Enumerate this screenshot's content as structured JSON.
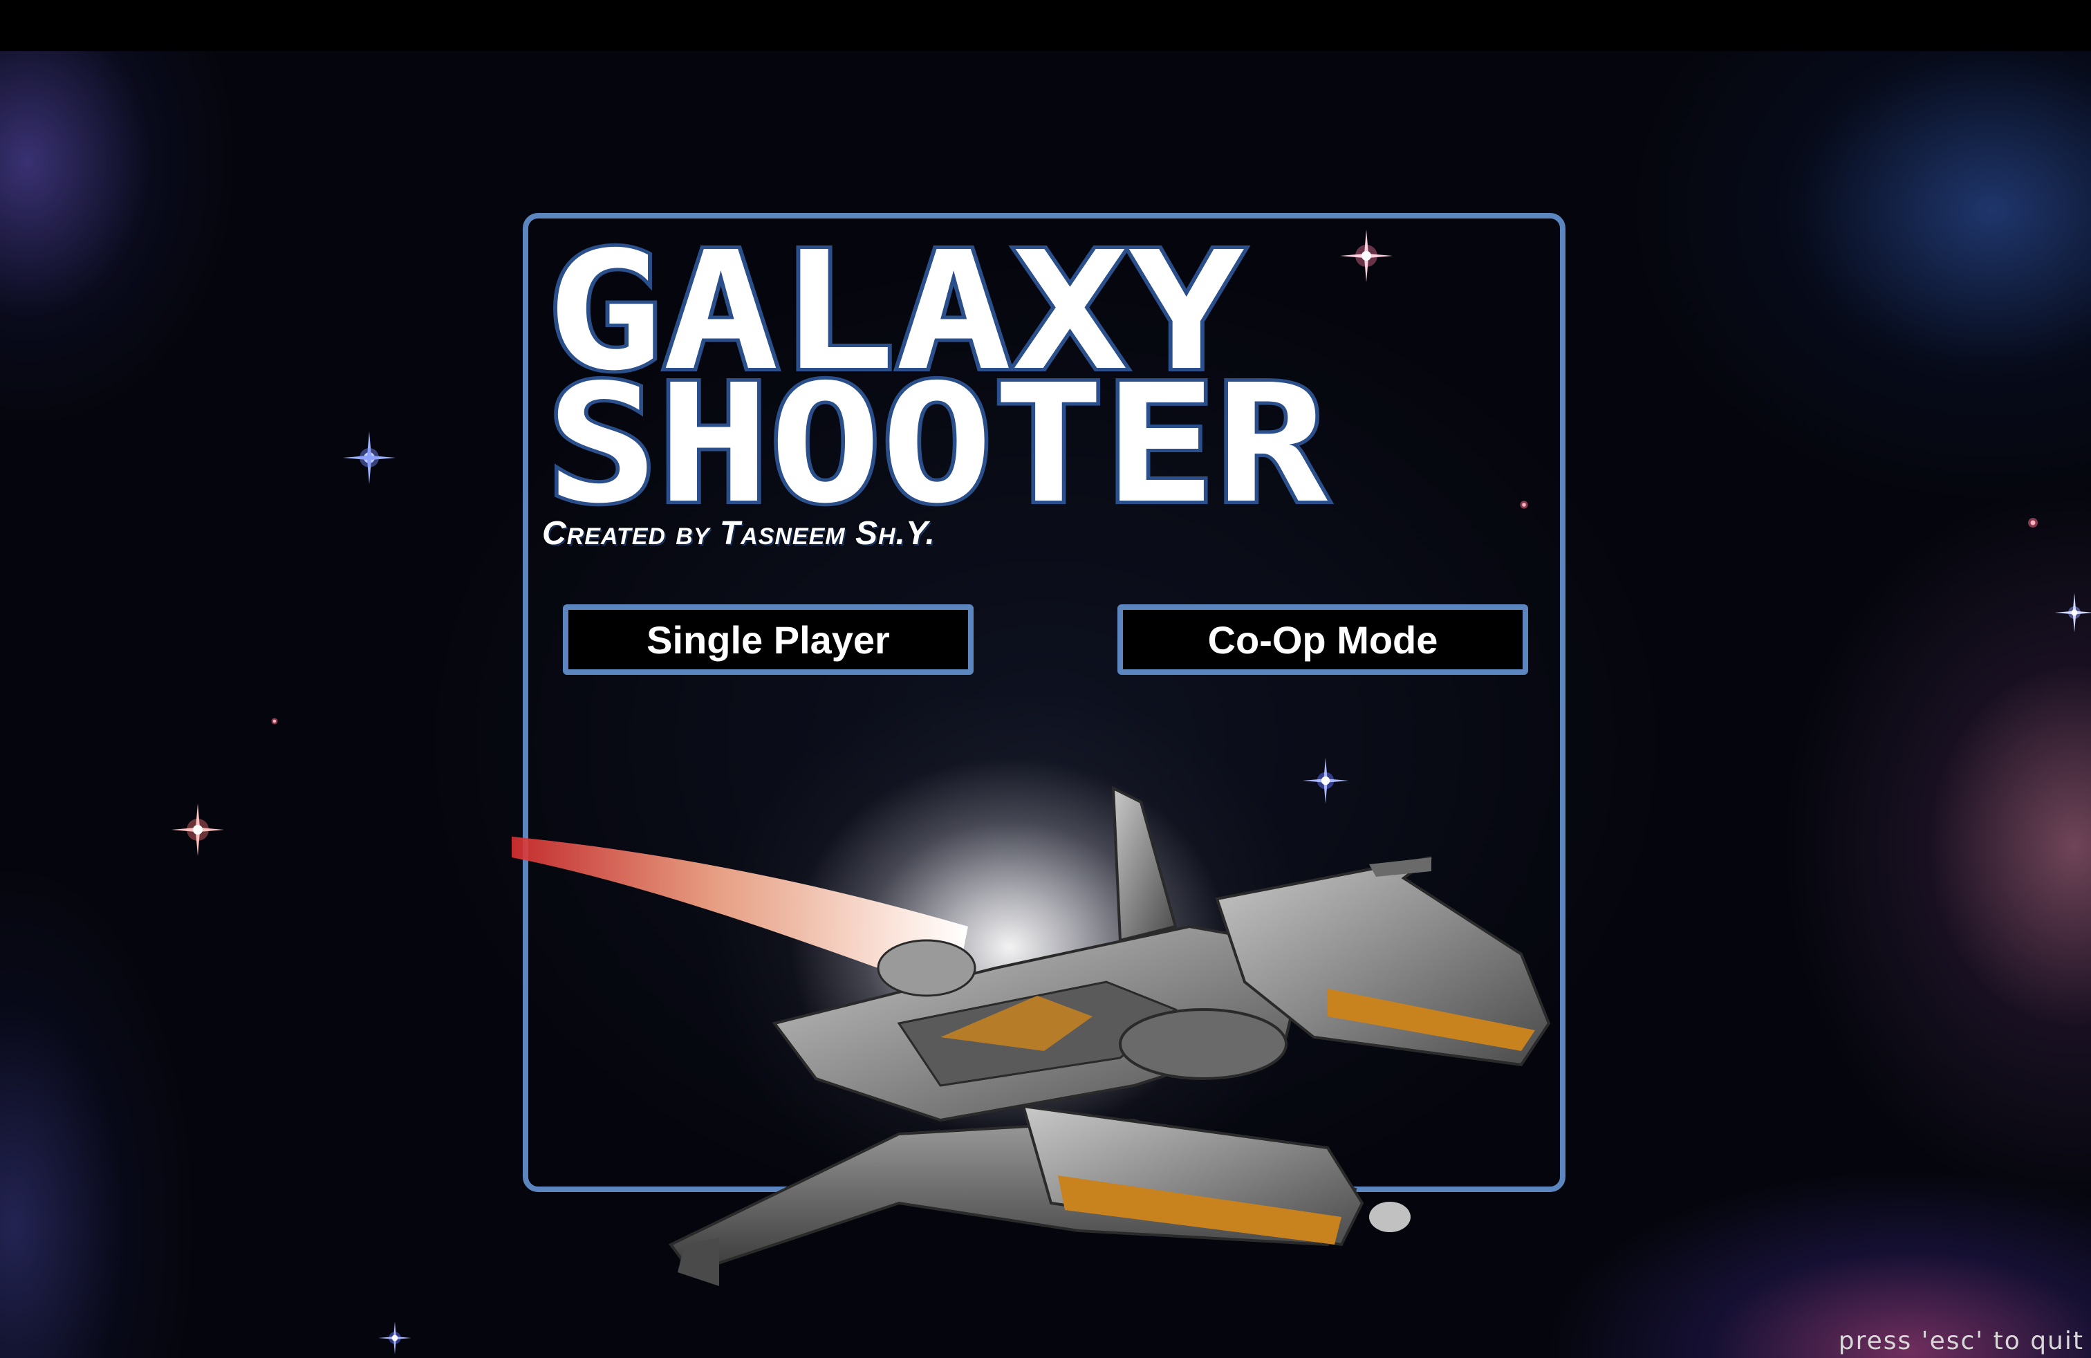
{
  "game": {
    "title_line1": "GALAXY",
    "title_line2": "SHOOTER",
    "credit": "Created by Tasneem Sh.Y."
  },
  "menu": {
    "single_player_label": "Single Player",
    "coop_label": "Co-Op Mode"
  },
  "footer": {
    "quit_hint": "press 'esc' to quit"
  },
  "colors": {
    "panel_border": "#5b86c0",
    "background": "#05060d",
    "text": "#ffffff"
  },
  "icons": [
    "star-icon",
    "spaceship-icon"
  ]
}
